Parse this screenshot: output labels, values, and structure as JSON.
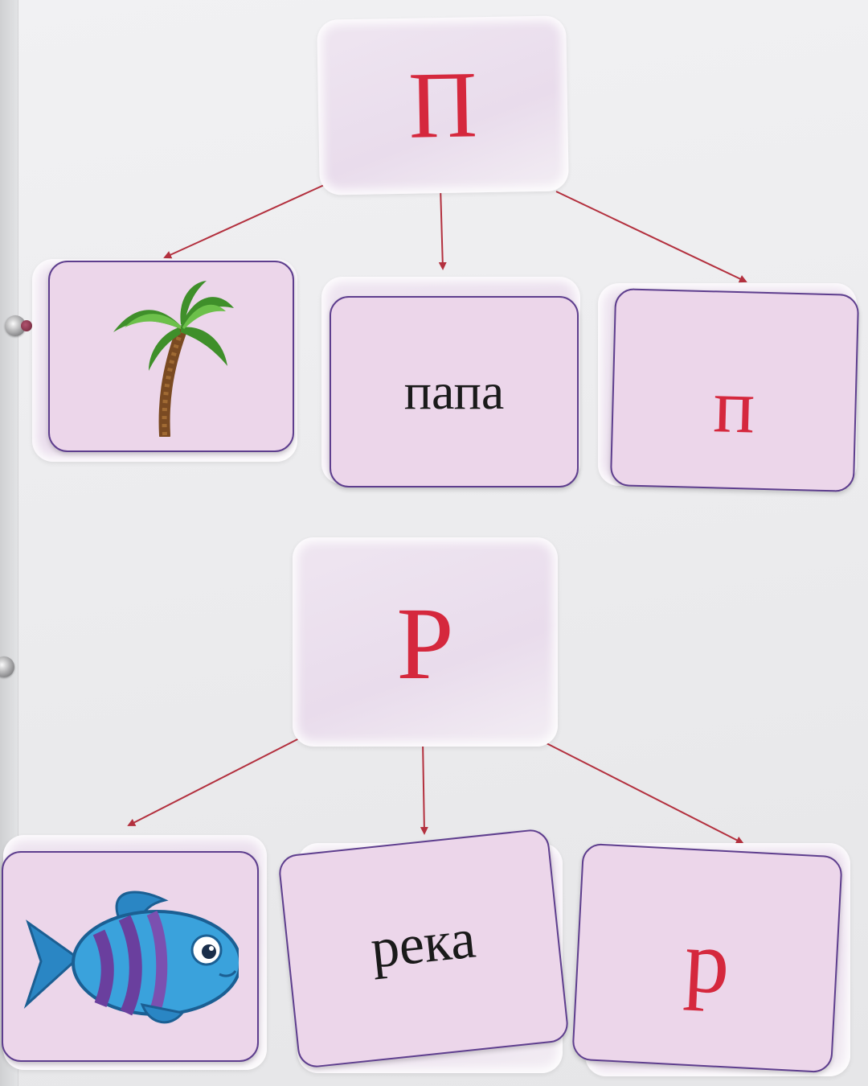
{
  "group_p": {
    "header_letter": "П",
    "cards": [
      {
        "type": "picture",
        "icon": "palm-tree-icon"
      },
      {
        "type": "word",
        "text": "папа"
      },
      {
        "type": "letter",
        "text": "п"
      }
    ]
  },
  "group_r": {
    "header_letter": "Р",
    "cards": [
      {
        "type": "picture",
        "icon": "fish-icon"
      },
      {
        "type": "word",
        "text": "река"
      },
      {
        "type": "letter",
        "text": "р"
      }
    ]
  },
  "colors": {
    "letter": "#d5283d",
    "card": "#ecd6ea",
    "card_border": "#5e3e8e",
    "arrow": "#b3303e"
  }
}
